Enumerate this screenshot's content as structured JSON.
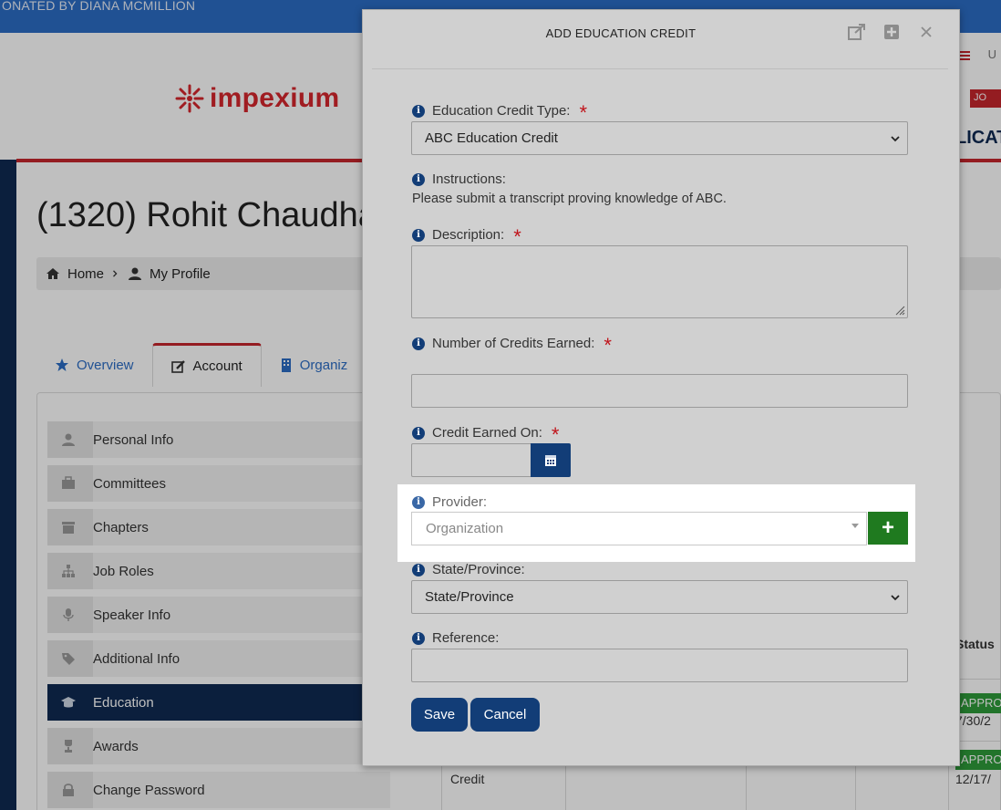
{
  "background": {
    "topbar_text": "ONATED BY DIANA MCMILLION",
    "logo_text": "impexium",
    "join_badge": "JO",
    "header_cut_text": "LICAT",
    "flag_text": "U",
    "page_title": "(1320) Rohit Chaudhar",
    "breadcrumb": {
      "home": "Home",
      "profile": "My Profile"
    },
    "tabs": [
      {
        "label": "Overview",
        "icon": "star-icon"
      },
      {
        "label": "Account",
        "icon": "edit-icon"
      },
      {
        "label": "Organiz",
        "icon": "building-icon"
      }
    ],
    "menu": [
      {
        "label": "Personal Info",
        "icon": "user-icon"
      },
      {
        "label": "Committees",
        "icon": "briefcase-icon"
      },
      {
        "label": "Chapters",
        "icon": "archive-icon"
      },
      {
        "label": "Job Roles",
        "icon": "sitemap-icon"
      },
      {
        "label": "Speaker Info",
        "icon": "microphone-icon"
      },
      {
        "label": "Additional Info",
        "icon": "tags-icon"
      },
      {
        "label": "Education",
        "icon": "graduation-cap-icon"
      },
      {
        "label": "Awards",
        "icon": "trophy-icon"
      },
      {
        "label": "Change Password",
        "icon": "lock-icon"
      }
    ],
    "table": {
      "status_header": "Status",
      "approved_1": "APPRO",
      "date_1": "7/30/2",
      "approved_2": "APPRO",
      "date_2": "12/17/",
      "credit_cell": "Credit"
    }
  },
  "modal": {
    "title": "ADD EDUCATION CREDIT",
    "fields": {
      "credit_type": {
        "label": "Education Credit Type:",
        "value": "ABC Education Credit"
      },
      "instructions": {
        "label": "Instructions:",
        "text": "Please submit a transcript proving knowledge of ABC."
      },
      "description": {
        "label": "Description:"
      },
      "credits_earned": {
        "label": "Number of Credits Earned:"
      },
      "credit_earned_on": {
        "label": "Credit Earned On:"
      },
      "provider": {
        "label": "Provider:",
        "placeholder": "Organization"
      },
      "state": {
        "label": "State/Province:",
        "value": "State/Province"
      },
      "reference": {
        "label": "Reference:"
      }
    },
    "required_mark": "*",
    "info_mark": "i",
    "add_symbol": "+",
    "buttons": {
      "save": "Save",
      "cancel": "Cancel"
    }
  },
  "colors": {
    "primary": "#123d77",
    "required": "#c0141b",
    "add_button": "#1f7a1f",
    "brand_red": "#d6262c"
  }
}
